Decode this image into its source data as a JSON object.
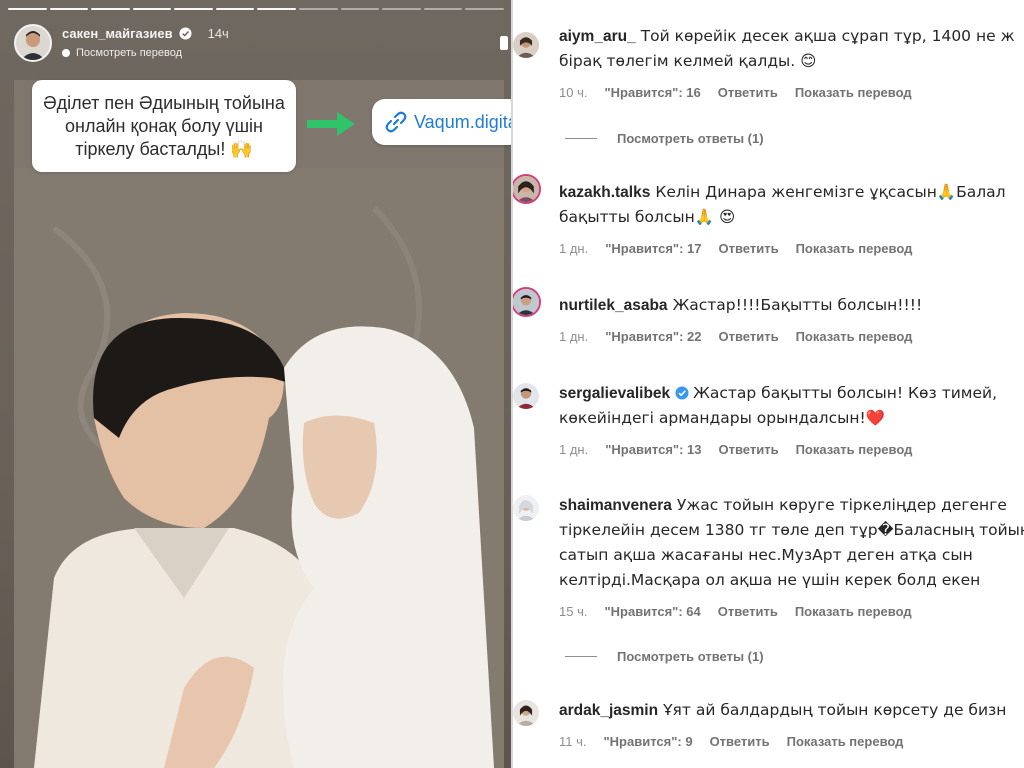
{
  "story": {
    "username": "сакен_майгазиев",
    "time": "14ч",
    "translate_label": "Посмотреть перевод",
    "title_text": "Әділет пен Әдиының тойына онлайн қонақ болу үшін тіркелу басталды! 🙌",
    "link_text": "Vaqum.digital",
    "arrow_color": "#2fc46a",
    "link_color": "#1f7cd6"
  },
  "comments": [
    {
      "username": "aiym_aru_",
      "text": "Той көрейік десек ақша сұрап тұр, 1400 не ж\nбірақ төлегім келмей қалды. 😊",
      "time": "10 ч.",
      "likes": "\"Нравится\": 16",
      "reply": "Ответить",
      "translate": "Показать перевод",
      "view_replies": "Посмотреть ответы (1)"
    },
    {
      "username": "kazakh.talks",
      "text": "Келін Динара женгемізге ұқсасын🙏Балал\nбақытты болсын🙏 😍",
      "time": "1 дн.",
      "likes": "\"Нравится\": 17",
      "reply": "Ответить",
      "translate": "Показать перевод"
    },
    {
      "username": "nurtilek_asaba",
      "text": "Жастар!!!!Бақытты болсын!!!!",
      "time": "1 дн.",
      "likes": "\"Нравится\": 22",
      "reply": "Ответить",
      "translate": "Показать перевод"
    },
    {
      "username": "sergalievalibek",
      "text": "Жастар бақытты болсын! Көз тимей,\nкөкейіндегі армандары орындалсын!❤️",
      "time": "1 дн.",
      "likes": "\"Нравится\": 13",
      "reply": "Ответить",
      "translate": "Показать перевод"
    },
    {
      "username": "shaimanvenera",
      "text": "Ужас тойын көруге тіркеліңдер дегенге\nтіркелейін десем 1380 тг төле деп тұр�Баласның тойын\nсатып ақша жасағаны нес.МузАрт деген атқа сын\nкелтірді.Масқара ол ақша не үшін керек болд екен",
      "time": "15 ч.",
      "likes": "\"Нравится\": 64",
      "reply": "Ответить",
      "translate": "Показать перевод",
      "view_replies": "Посмотреть ответы (1)"
    },
    {
      "username": "ardak_jasmin",
      "text": "Ұят ай балдардың тойын көрсету де бизн",
      "time": "11 ч.",
      "likes": "\"Нравится\": 9",
      "reply": "Ответить",
      "translate": "Показать перевод"
    }
  ]
}
